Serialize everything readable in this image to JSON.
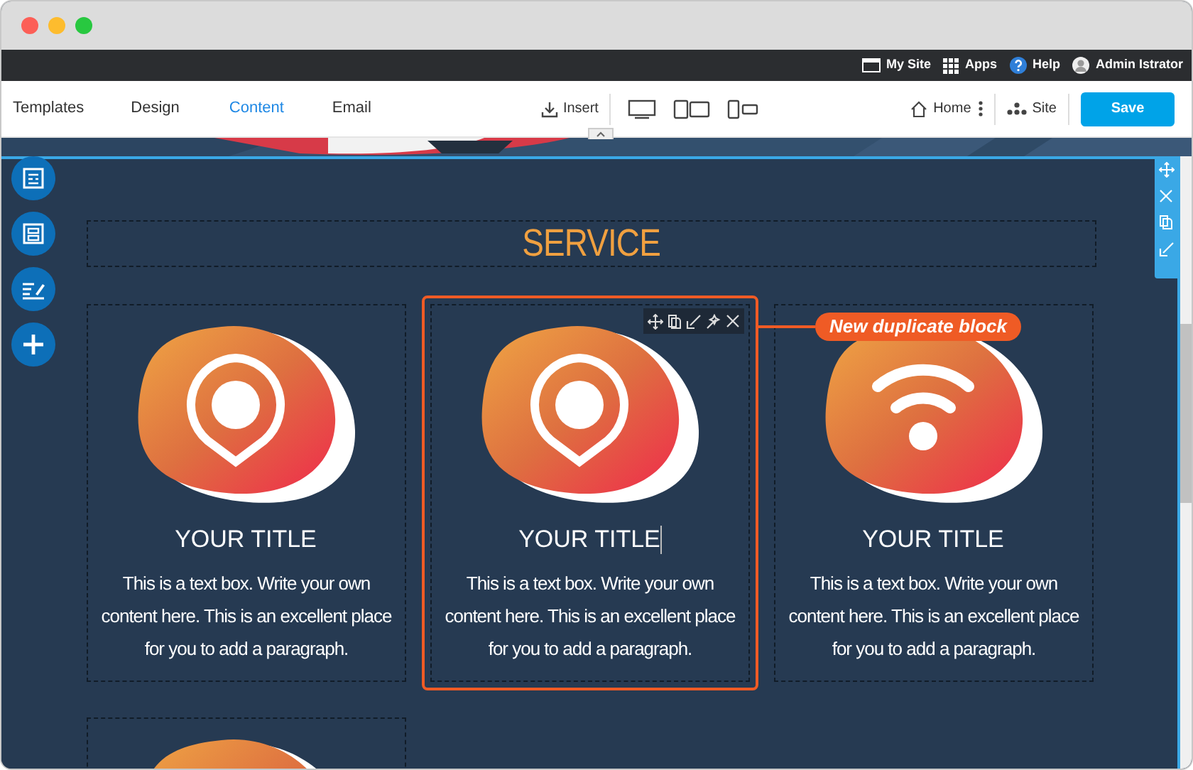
{
  "top_bar": [
    {
      "kind": "site",
      "label": "My Site"
    },
    {
      "kind": "apps",
      "label": "Apps"
    },
    {
      "kind": "help",
      "label": "Help"
    },
    {
      "kind": "user",
      "label": "Admin Istrator"
    }
  ],
  "nav": {
    "tabs": [
      {
        "label": "Templates",
        "selected": false
      },
      {
        "label": "Design",
        "selected": false
      },
      {
        "label": "Content",
        "selected": true
      },
      {
        "label": "Email",
        "selected": false
      }
    ],
    "insert": "Insert",
    "home": "Home",
    "site": "Site",
    "save": "Save"
  },
  "section_title": "SERVICE",
  "cards": [
    {
      "kind": "pin",
      "title": "YOUR TITLE",
      "body": "This is a text box. Write your own content here. This is an excellent place for you to add a paragraph.",
      "selected": false,
      "editing": false
    },
    {
      "kind": "pin",
      "title": "YOUR TITLE",
      "body": "This is a text box. Write your own content here. This is an excellent place for you to add a paragraph.",
      "selected": true,
      "editing": true
    },
    {
      "kind": "wifi",
      "title": "YOUR TITLE",
      "body": "This is a text box. Write your own content here. This is an excellent place for you to add a paragraph.",
      "selected": false,
      "editing": false
    },
    {
      "kind": "blank",
      "selected": false
    }
  ],
  "callout": "New duplicate block"
}
